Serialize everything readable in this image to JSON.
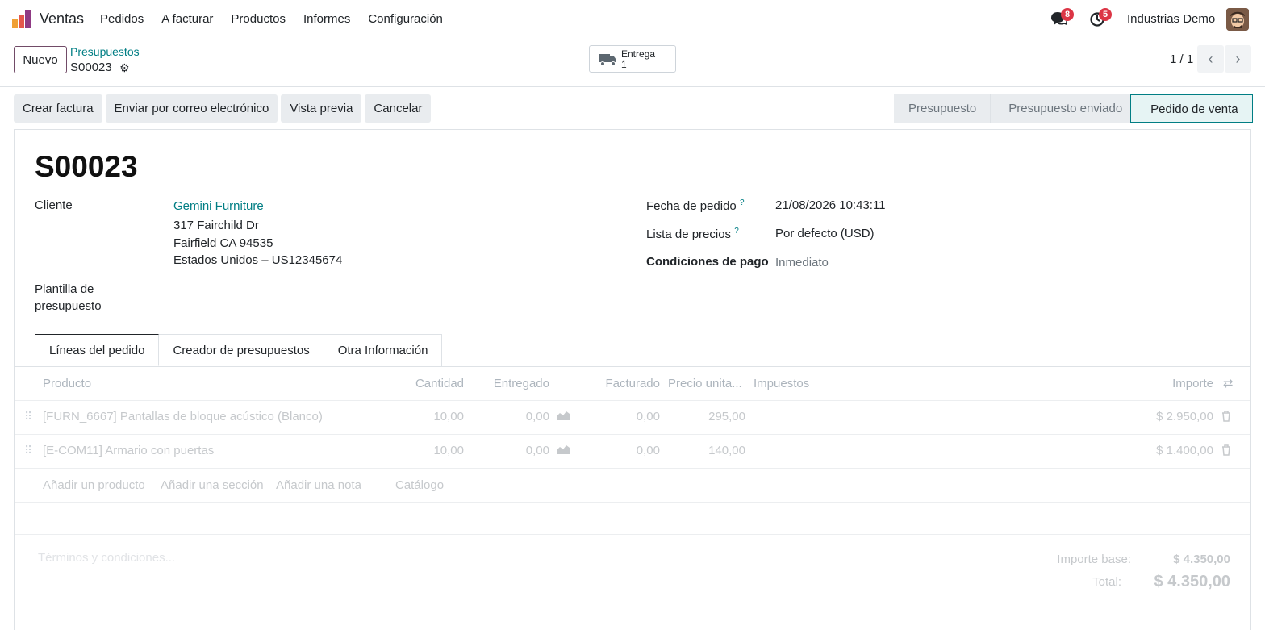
{
  "nav": {
    "app_name": "Ventas",
    "menu": [
      "Pedidos",
      "A facturar",
      "Productos",
      "Informes",
      "Configuración"
    ],
    "messages_count": "8",
    "activities_count": "5",
    "company": "Industrias Demo"
  },
  "control": {
    "new_label": "Nuevo",
    "breadcrumb_parent": "Presupuestos",
    "breadcrumb_current": "S00023",
    "delivery_label": "Entrega",
    "delivery_count": "1",
    "pager": "1 / 1"
  },
  "actions": [
    "Crear factura",
    "Enviar por correo electrónico",
    "Vista previa",
    "Cancelar"
  ],
  "statusbar": [
    "Presupuesto",
    "Presupuesto enviado",
    "Pedido de venta"
  ],
  "form": {
    "title": "S00023",
    "customer_label": "Cliente",
    "customer_name": "Gemini Furniture",
    "address_line1": "317 Fairchild Dr",
    "address_line2": "Fairfield CA 94535",
    "address_line3": "Estados Unidos – US12345674",
    "template_label_1": "Plantilla de",
    "template_label_2": "presupuesto",
    "order_date_label": "Fecha de pedido",
    "order_date": "21/08/2026 10:43:11",
    "pricelist_label": "Lista de precios",
    "pricelist": "Por defecto (USD)",
    "payment_terms_label": "Condiciones de pago",
    "payment_terms": "Inmediato",
    "help_mark": "?"
  },
  "tabs": [
    "Líneas del pedido",
    "Creador de presupuestos",
    "Otra Información"
  ],
  "table": {
    "headers": {
      "product": "Producto",
      "quantity": "Cantidad",
      "delivered": "Entregado",
      "invoiced": "Facturado",
      "unit_price": "Precio unita...",
      "taxes": "Impuestos",
      "amount": "Importe"
    },
    "rows": [
      {
        "product": "[FURN_6667] Pantallas de bloque acústico (Blanco)",
        "quantity": "10,00",
        "delivered": "0,00",
        "invoiced": "0,00",
        "unit_price": "295,00",
        "taxes": "",
        "amount": "$ 2.950,00"
      },
      {
        "product": "[E-COM11] Armario con puertas",
        "quantity": "10,00",
        "delivered": "0,00",
        "invoiced": "0,00",
        "unit_price": "140,00",
        "taxes": "",
        "amount": "$ 1.400,00"
      }
    ],
    "add_product": "Añadir un producto",
    "add_section": "Añadir una sección",
    "add_note": "Añadir una nota",
    "catalog": "Catálogo"
  },
  "footer": {
    "terms_placeholder": "Términos y condiciones...",
    "base_label": "Importe base:",
    "base_amount": "$ 4.350,00",
    "total_label": "Total:",
    "total_amount": "$ 4.350,00"
  }
}
